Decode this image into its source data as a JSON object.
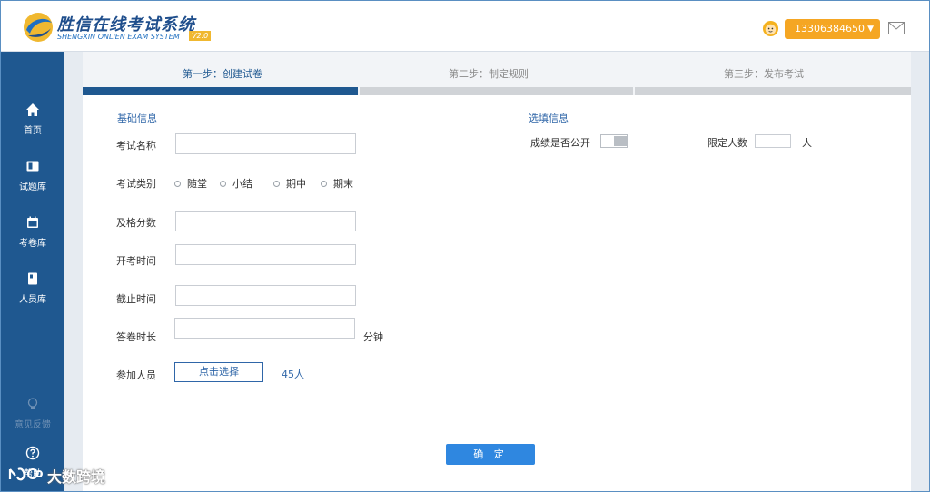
{
  "header": {
    "app_title": "胜信在线考试系统",
    "app_subtitle": "SHENGXIN ONLIEN EXAM SYSTEM",
    "version": "V2.0",
    "user_phone": "13306384650",
    "user_caret": "▼"
  },
  "sidebar": {
    "items": [
      {
        "label": "首页",
        "icon": "home-icon"
      },
      {
        "label": "试题库",
        "icon": "question-bank-icon"
      },
      {
        "label": "考卷库",
        "icon": "calendar-icon"
      },
      {
        "label": "人员库",
        "icon": "book-icon"
      },
      {
        "label": "意见反馈",
        "icon": "lightbulb-icon"
      },
      {
        "label": "帮助",
        "icon": "help-icon"
      }
    ]
  },
  "steps": [
    {
      "label": "第一步：创建试卷",
      "active": true
    },
    {
      "label": "第二步：制定规则",
      "active": false
    },
    {
      "label": "第三步：发布考试",
      "active": false
    }
  ],
  "basic": {
    "section_title": "基础信息",
    "exam_name_label": "考试名称",
    "exam_name_value": "",
    "category_label": "考试类别",
    "categories": [
      "随堂",
      "小结",
      "期中",
      "期末"
    ],
    "pass_score_label": "及格分数",
    "pass_score_value": "",
    "start_time_label": "开考时间",
    "start_time_value": "",
    "end_time_label": "截止时间",
    "end_time_value": "",
    "duration_label": "答卷时长",
    "duration_value": "",
    "duration_unit": "分钟",
    "participants_label": "参加人员",
    "select_button": "点击选择",
    "participant_count": "45人"
  },
  "options": {
    "section_title": "选填信息",
    "public_score_label": "成绩是否公开",
    "public_score_on": false,
    "limit_label": "限定人数",
    "limit_value": "",
    "limit_unit": "人"
  },
  "confirm_button": "确 定",
  "watermark_text": "大数跨境",
  "colors": {
    "sidebar": "#1f5890",
    "accent": "#2f66a8",
    "user_badge": "#f5a623",
    "confirm": "#2f87e0"
  }
}
